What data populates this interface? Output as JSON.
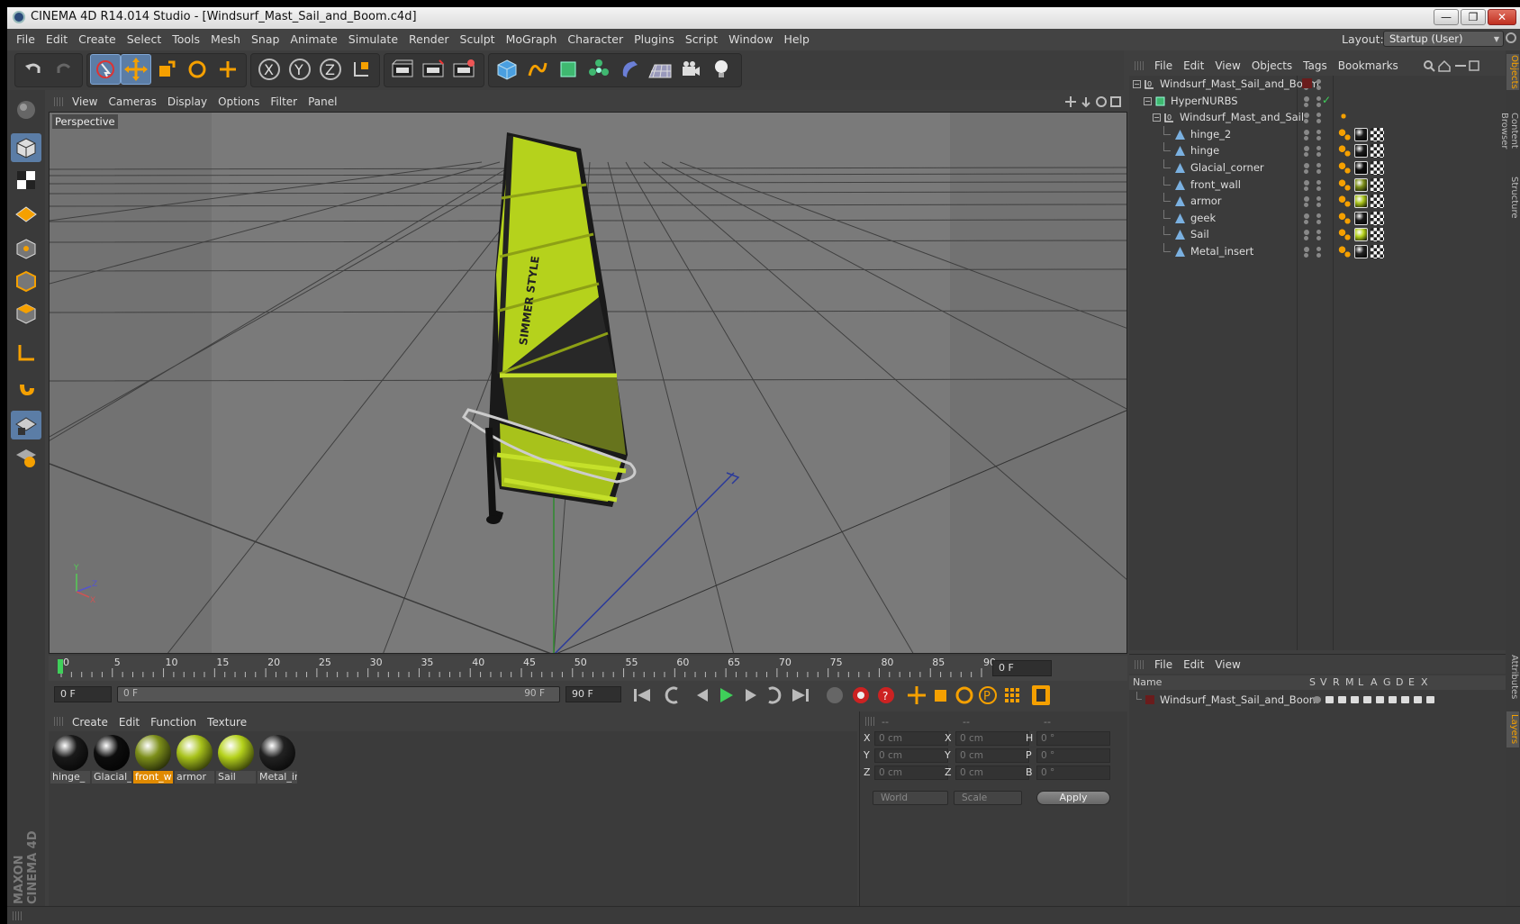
{
  "window": {
    "title": "CINEMA 4D R14.014 Studio - [Windsurf_Mast_Sail_and_Boom.c4d]",
    "minimize": "—",
    "restore": "❐",
    "close": "✕"
  },
  "menu": [
    "File",
    "Edit",
    "Create",
    "Select",
    "Tools",
    "Mesh",
    "Snap",
    "Animate",
    "Simulate",
    "Render",
    "Sculpt",
    "MoGraph",
    "Character",
    "Plugins",
    "Script",
    "Window",
    "Help"
  ],
  "layout": {
    "label": "Layout:",
    "value": "Startup (User)"
  },
  "viewport": {
    "menu": [
      "View",
      "Cameras",
      "Display",
      "Options",
      "Filter",
      "Panel"
    ],
    "camera": "Perspective",
    "sail_text": "SIMMER STYLE",
    "axis_y": "Y",
    "axis_z": "Z",
    "axis_x": "X"
  },
  "timeline": {
    "ticks": [
      "0",
      "5",
      "10",
      "15",
      "20",
      "25",
      "30",
      "35",
      "40",
      "45",
      "50",
      "55",
      "60",
      "65",
      "70",
      "75",
      "80",
      "85",
      "90"
    ],
    "current_frame": "0 F",
    "start_field": "0 F",
    "range_start": "0 F",
    "range_end": "90 F",
    "end_field": "90 F"
  },
  "material_manager": {
    "menu": [
      "Create",
      "Edit",
      "Function",
      "Texture"
    ],
    "materials": [
      {
        "label": "hinge_",
        "color": "#1a1a1a",
        "selected": false
      },
      {
        "label": "Glacial_",
        "color": "#0d0d0d",
        "selected": false
      },
      {
        "label": "front_w",
        "color": "#7d8f1a",
        "selected": true
      },
      {
        "label": "armor",
        "color": "#a8c21b",
        "selected": false
      },
      {
        "label": "Sail",
        "color": "#b5d21c",
        "selected": false
      },
      {
        "label": "Metal_ir",
        "color": "#222222",
        "selected": false
      }
    ]
  },
  "coordinates": {
    "headers": [
      "--",
      "--",
      "--"
    ],
    "rows": [
      {
        "l1": "X",
        "v1": "0 cm",
        "l2": "X",
        "v2": "0 cm",
        "l3": "H",
        "v3": "0 °"
      },
      {
        "l1": "Y",
        "v1": "0 cm",
        "l2": "Y",
        "v2": "0 cm",
        "l3": "P",
        "v3": "0 °"
      },
      {
        "l1": "Z",
        "v1": "0 cm",
        "l2": "Z",
        "v2": "0 cm",
        "l3": "B",
        "v3": "0 °"
      }
    ],
    "space": "World",
    "mode": "Scale",
    "apply": "Apply"
  },
  "object_manager": {
    "menu": [
      "File",
      "Edit",
      "View",
      "Objects",
      "Tags",
      "Bookmarks"
    ],
    "objects": [
      {
        "name": "Windsurf_Mast_Sail_and_Boom",
        "level": 0,
        "icon": "null-icon"
      },
      {
        "name": "HyperNURBS",
        "level": 1,
        "icon": "hypernurbs-icon"
      },
      {
        "name": "Windsurf_Mast_and_Sail",
        "level": 2,
        "icon": "null-icon"
      },
      {
        "name": "hinge_2",
        "level": 3,
        "icon": "polygon-icon",
        "mat": "#1a1a1a"
      },
      {
        "name": "hinge",
        "level": 3,
        "icon": "polygon-icon",
        "mat": "#1a1a1a"
      },
      {
        "name": "Glacial_corner",
        "level": 3,
        "icon": "polygon-icon",
        "mat": "#0d0d0d"
      },
      {
        "name": "front_wall",
        "level": 3,
        "icon": "polygon-icon",
        "mat": "#7d8f1a"
      },
      {
        "name": "armor",
        "level": 3,
        "icon": "polygon-icon",
        "mat": "#a8c21b"
      },
      {
        "name": "geek",
        "level": 3,
        "icon": "polygon-icon",
        "mat": "#1a1a1a"
      },
      {
        "name": "Sail",
        "level": 3,
        "icon": "polygon-icon",
        "mat": "#b5d21c"
      },
      {
        "name": "Metal_insert",
        "level": 3,
        "icon": "polygon-icon",
        "mat": "#222222"
      }
    ]
  },
  "layer_manager": {
    "menu": [
      "File",
      "Edit",
      "View"
    ],
    "columns": [
      "Name",
      "S",
      "V",
      "R",
      "M",
      "L",
      "A",
      "G",
      "D",
      "E",
      "X"
    ],
    "layers": [
      {
        "name": "Windsurf_Mast_Sail_and_Boom"
      }
    ]
  },
  "side_tabs": [
    "Objects",
    "Content Browser",
    "Structure",
    "Attributes",
    "Layers"
  ],
  "brand": "MAXON CINEMA 4D"
}
